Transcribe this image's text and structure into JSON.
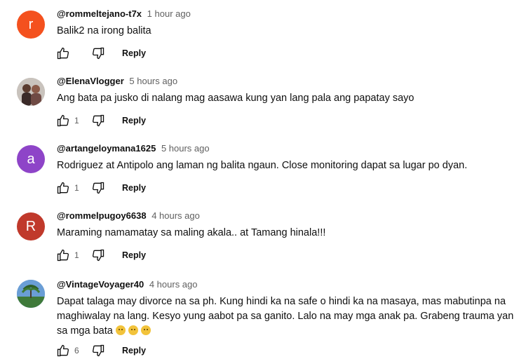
{
  "comments": [
    {
      "author": "@rommeltejano-t7x",
      "time": "1 hour ago",
      "text": "Balik2 na irong balita",
      "likes": "",
      "reply_label": "Reply",
      "avatar_letter": "r",
      "avatar_color": "#f4511e"
    },
    {
      "author": "@ElenaVlogger",
      "time": "5 hours ago",
      "text": "Ang bata pa jusko di nalang mag aasawa kung yan lang pala ang papatay sayo",
      "likes": "1",
      "reply_label": "Reply",
      "avatar_letter": "",
      "avatar_color": "#b9b2ad"
    },
    {
      "author": "@artangeloymana1625",
      "time": "5 hours ago",
      "text": "Rodriguez at Antipolo ang laman ng balita ngaun. Close monitoring dapat sa lugar po dyan.",
      "likes": "1",
      "reply_label": "Reply",
      "avatar_letter": "a",
      "avatar_color": "#8e44c8"
    },
    {
      "author": "@rommelpugoy6638",
      "time": "4 hours ago",
      "text": "Maraming namamatay sa  maling akala.. at Tamang hinala!!!",
      "likes": "1",
      "reply_label": "Reply",
      "avatar_letter": "R",
      "avatar_color": "#c0392b"
    },
    {
      "author": "@VintageVoyager40",
      "time": "4 hours ago",
      "text": "Dapat talaga may divorce na sa ph. Kung hindi ka na safe o hindi ka na masaya, mas mabutinpa na maghiwalay na lang. Kesyo yung aabot pa sa ganito. Lalo na may mga anak pa. Grabeng trauma yan sa mga bata",
      "likes": "6",
      "reply_label": "Reply",
      "avatar_letter": "",
      "avatar_color": "#5b8fc8"
    }
  ]
}
